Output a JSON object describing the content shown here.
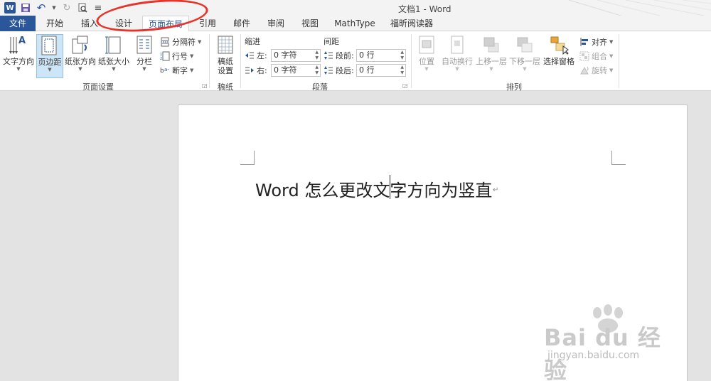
{
  "app": {
    "title": "文档1 - Word",
    "logo_letter": "W"
  },
  "qat": {
    "icons": [
      "word-logo",
      "save-icon",
      "undo-icon",
      "redo-icon",
      "print-preview-icon",
      "customize-icon"
    ],
    "undo_glyph": "↶",
    "redo_glyph": "↻",
    "customize_glyph": "≡"
  },
  "tabs": [
    {
      "label": "文件"
    },
    {
      "label": "开始"
    },
    {
      "label": "插入"
    },
    {
      "label": "设计"
    },
    {
      "label": "页面布局"
    },
    {
      "label": "引用"
    },
    {
      "label": "邮件"
    },
    {
      "label": "审阅"
    },
    {
      "label": "视图"
    },
    {
      "label": "MathType"
    },
    {
      "label": "福昕阅读器"
    }
  ],
  "ribbon": {
    "page_setup": {
      "label": "页面设置",
      "text_direction": "文字方向",
      "margins": "页边距",
      "orientation": "纸张方向",
      "size": "纸张大小",
      "columns": "分栏",
      "breaks": "分隔符",
      "line_numbers": "行号",
      "hyphenation": "断字"
    },
    "draft": {
      "label": "稿纸",
      "settings": "稿纸\n设置",
      "settings_line1": "稿纸",
      "settings_line2": "设置"
    },
    "paragraph": {
      "label": "段落",
      "indent_title": "缩进",
      "spacing_title": "间距",
      "left_label": "左:",
      "right_label": "右:",
      "left_value": "0 字符",
      "right_value": "0 字符",
      "before_label": "段前:",
      "after_label": "段后:",
      "before_value": "0 行",
      "after_value": "0 行"
    },
    "arrange": {
      "label": "排列",
      "position": "位置",
      "wrap_text": "自动换行",
      "bring_forward": "上移一层",
      "send_backward": "下移一层",
      "selection_pane": "选择窗格",
      "align": "对齐",
      "group": "组合",
      "rotate": "旋转"
    }
  },
  "document": {
    "text": "Word 怎么更改文字方向为竖直",
    "paragraph_mark": "↵"
  },
  "watermark": {
    "brand": "Bai du 经验",
    "site": "jingyan.baidu.com"
  },
  "colors": {
    "accent": "#2b579a",
    "highlight": "#e8332a",
    "selected_button": "#cde6f7"
  }
}
